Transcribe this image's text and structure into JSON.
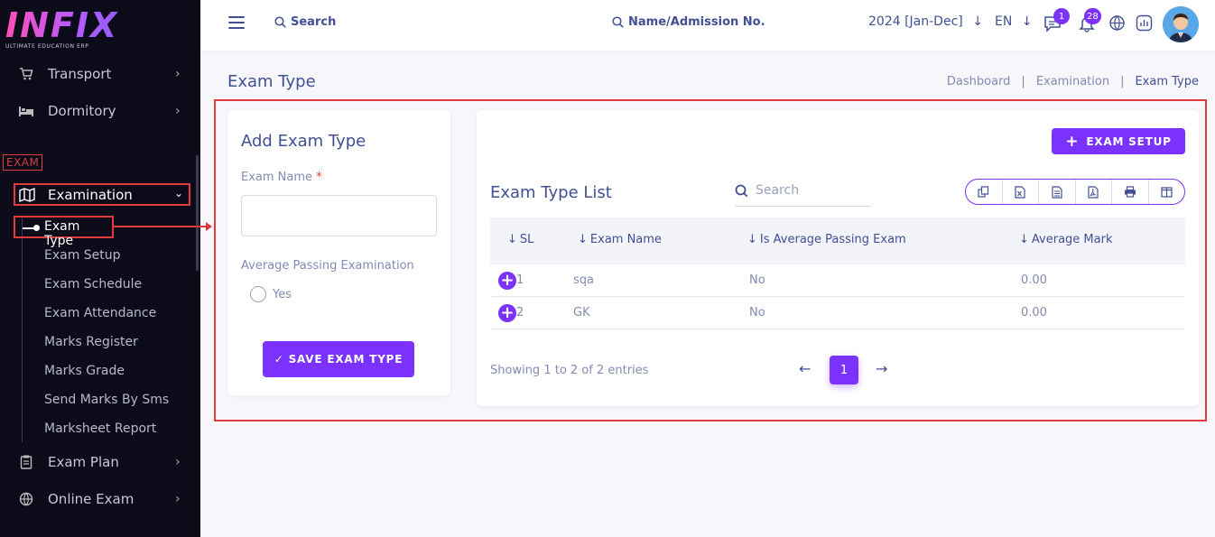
{
  "logo": {
    "mark": "INFIX",
    "subtitle": "ULTIMATE EDUCATION ERP"
  },
  "sidebar": {
    "top_items": [
      {
        "label": "Transport",
        "icon": "cart-icon"
      },
      {
        "label": "Dormitory",
        "icon": "bed-icon"
      }
    ],
    "section_label": "EXAM",
    "active_menu": {
      "label": "Examination",
      "icon": "map-icon"
    },
    "submenu": [
      "Exam Type",
      "Exam Setup",
      "Exam Schedule",
      "Exam Attendance",
      "Marks Register",
      "Marks Grade",
      "Send Marks By Sms",
      "Marksheet Report"
    ],
    "bottom_items": [
      {
        "label": "Exam Plan",
        "icon": "clipboard-icon"
      },
      {
        "label": "Online Exam",
        "icon": "globe-icon"
      }
    ]
  },
  "topbar": {
    "search_label": "Search",
    "name_search_label": "Name/Admission No.",
    "academic_year": "2024 [Jan-Dec]",
    "language": "EN",
    "chat_badge": "1",
    "notification_badge": "28"
  },
  "page": {
    "title": "Exam Type",
    "breadcrumb": [
      "Dashboard",
      "Examination",
      "Exam Type"
    ]
  },
  "add_form": {
    "title": "Add Exam Type",
    "exam_name_label": "Exam Name",
    "required_mark": "*",
    "exam_name_value": "",
    "avg_label": "Average Passing Examination",
    "radio_label": "Yes",
    "save_label": "SAVE EXAM TYPE"
  },
  "list": {
    "exam_setup_label": "EXAM SETUP",
    "title": "Exam Type List",
    "search_placeholder": "Search",
    "columns": [
      "SL",
      "Exam Name",
      "Is Average Passing Exam",
      "Average Mark"
    ],
    "rows": [
      {
        "sl": "1",
        "name": "sqa",
        "avg_passing": "No",
        "avg_mark": "0.00"
      },
      {
        "sl": "2",
        "name": "GK",
        "avg_passing": "No",
        "avg_mark": "0.00"
      }
    ],
    "showing": "Showing 1 to 2 of 2 entries",
    "current_page": "1"
  },
  "colors": {
    "accent": "#7c32ff",
    "sidebar_bg": "#0b0b1a",
    "text_primary": "#415094",
    "highlight_red": "#e03c3c"
  }
}
